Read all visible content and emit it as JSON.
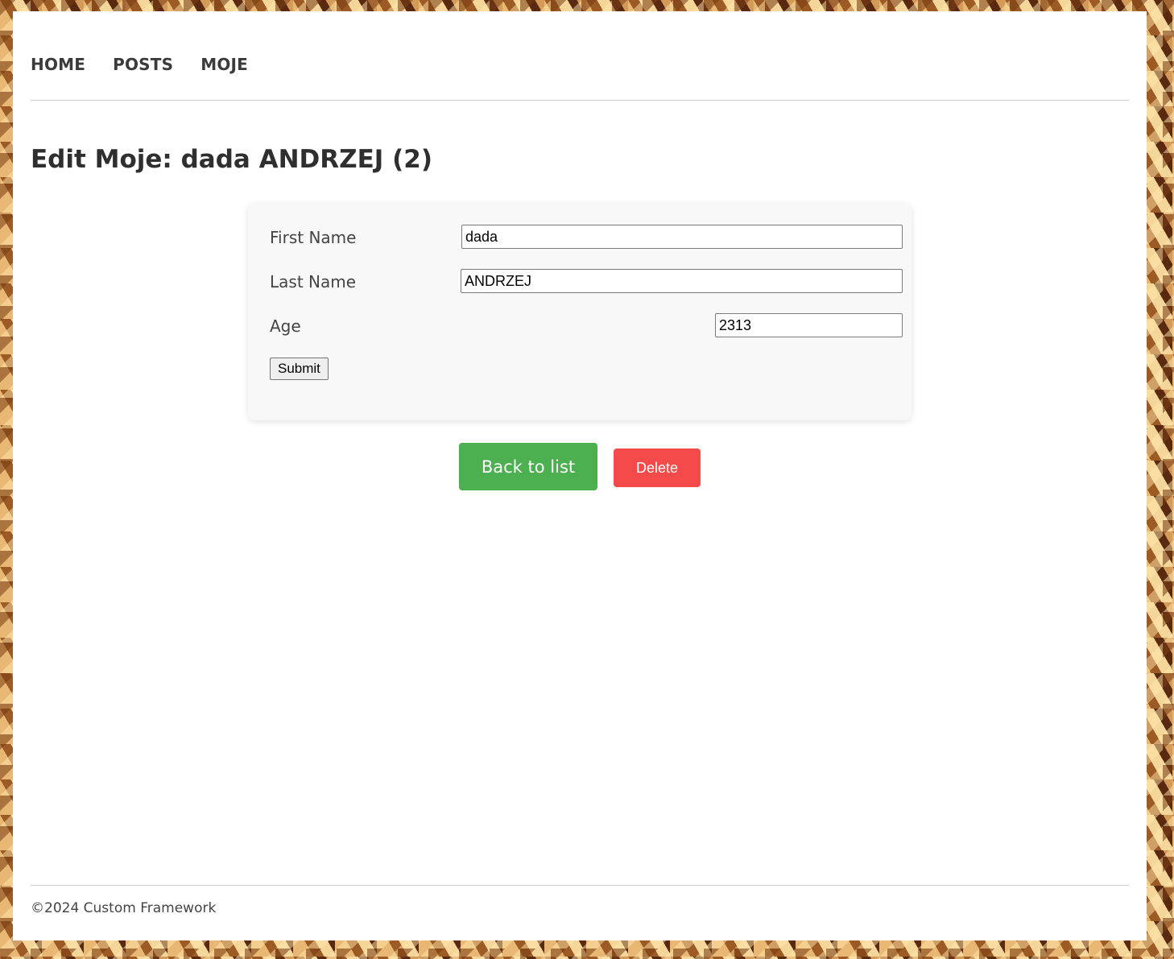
{
  "nav": {
    "items": [
      "HOME",
      "POSTS",
      "MOJE"
    ]
  },
  "page": {
    "title": "Edit Moje: dada ANDRZEJ (2)"
  },
  "form": {
    "first_name_label": "First Name",
    "first_name_value": "dada",
    "last_name_label": "Last Name",
    "last_name_value": "ANDRZEJ",
    "age_label": "Age",
    "age_value": "2313",
    "submit_label": "Submit"
  },
  "actions": {
    "back_label": "Back to list",
    "delete_label": "Delete"
  },
  "footer": {
    "text": "©2024 Custom Framework"
  },
  "colors": {
    "back_button": "#4caf50",
    "delete_button": "#f44a4a"
  }
}
